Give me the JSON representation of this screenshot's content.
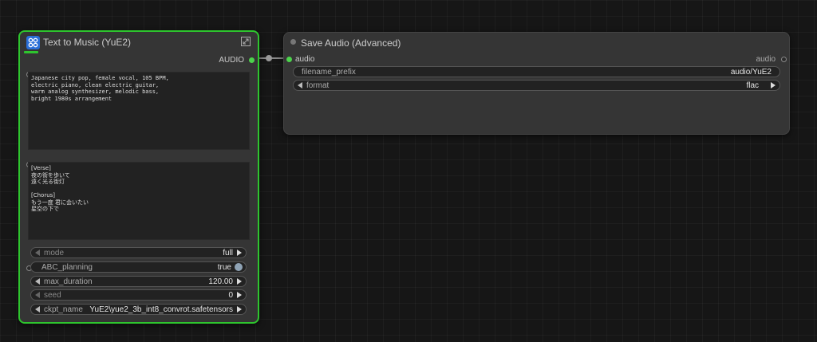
{
  "node_text_to_music": {
    "title": "Text to Music (YuE2)",
    "output_label": "AUDIO",
    "genre_prompt": "Japanese city pop, female vocal, 105 BPM,\nelectric piano, clean electric guitar,\nwarm analog synthesizer, melodic bass,\nbright 1980s arrangement",
    "lyrics": "[Verse]\n夜の街を歩いて\n遠く光る街灯\n\n[Chorus]\nもう一度 君に会いたい\n星空の下で",
    "widgets": {
      "mode": {
        "label": "mode",
        "value": "full"
      },
      "abc_planning": {
        "label": "ABC_planning",
        "value": "true"
      },
      "max_duration": {
        "label": "max_duration",
        "value": "120.00"
      },
      "seed": {
        "label": "seed",
        "value": "0"
      },
      "ckpt_name": {
        "label": "ckpt_name",
        "value": "YuE2\\yue2_3b_int8_convrot.safetensors"
      }
    }
  },
  "node_save_audio": {
    "title": "Save Audio (Advanced)",
    "input_label": "audio",
    "output_label": "audio",
    "widgets": {
      "filename_prefix": {
        "label": "filename_prefix",
        "value": "audio/YuE2"
      },
      "format": {
        "label": "format",
        "value": "flac"
      }
    }
  },
  "colors": {
    "selected_border": "#2ec52e",
    "slot_green": "#4cd34c",
    "canvas_bg": "#161616",
    "node_bg": "#353535"
  },
  "icons": [
    "node-logo-icon",
    "expand-icon",
    "arrow-left-icon",
    "arrow-right-icon",
    "toggle-knob-icon"
  ]
}
